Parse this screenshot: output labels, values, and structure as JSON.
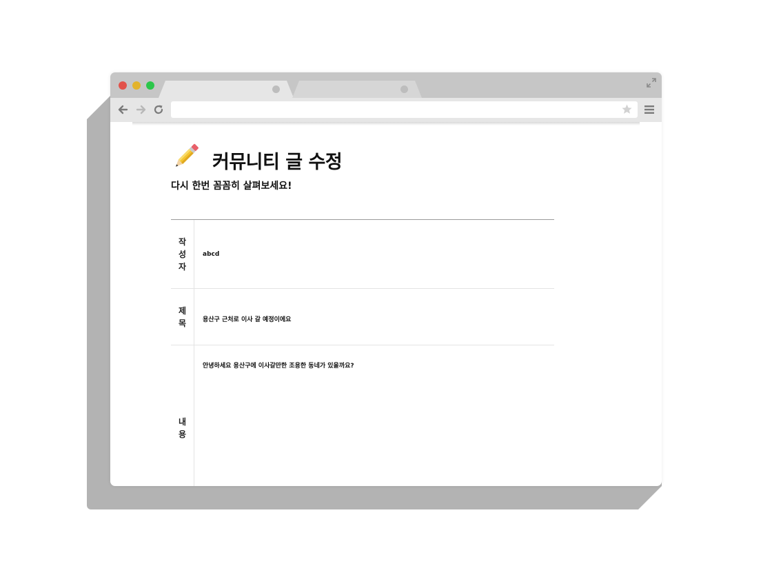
{
  "browser": {
    "tabs": [
      {
        "label": "",
        "active": true
      },
      {
        "label": "",
        "active": false
      }
    ],
    "url": ""
  },
  "page": {
    "title": "커뮤니티 글 수정",
    "subtitle": "다시 한번 꼼꼼히 살펴보세요!",
    "title_icon": "pencil-icon"
  },
  "form": {
    "rows": [
      {
        "label": "작성자",
        "value": "abcd"
      },
      {
        "label": "제목",
        "value": "용산구 근처로 이사 갈 예정이에요"
      },
      {
        "label": "내용",
        "value": "안녕하세요 용산구에 이사갈만한 조용한 동네가 있을까요?"
      }
    ]
  },
  "colors": {
    "traffic_red": "#e2524a",
    "traffic_yellow": "#e3b32c",
    "traffic_green": "#2bc64a"
  }
}
